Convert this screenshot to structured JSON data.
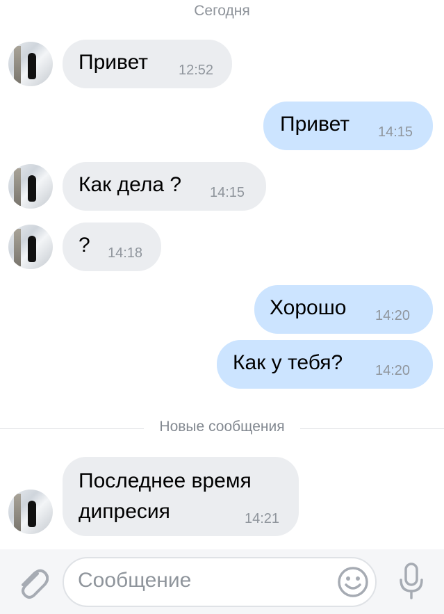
{
  "date_label": "Сегодня",
  "messages": [
    {
      "text": "Привет",
      "time": "12:52"
    },
    {
      "text": "Привет",
      "time": "14:15"
    },
    {
      "text": "Как дела ?",
      "time": "14:15"
    },
    {
      "text": "?",
      "time": "14:18"
    },
    {
      "text": "Хорошо",
      "time": "14:20"
    },
    {
      "text": "Как у тебя?",
      "time": "14:20"
    },
    {
      "line1": "Последнее время",
      "line2": "дипресия",
      "time": "14:21"
    }
  ],
  "new_messages_label": "Новые сообщения",
  "input": {
    "placeholder": "Сообщение"
  },
  "icons": {
    "attach": "paperclip-icon",
    "emoji": "smile-icon",
    "voice": "microphone-icon"
  },
  "colors": {
    "incoming_bubble": "#ebedf0",
    "outgoing_bubble": "#cce4ff",
    "icon": "#a6abb3"
  }
}
